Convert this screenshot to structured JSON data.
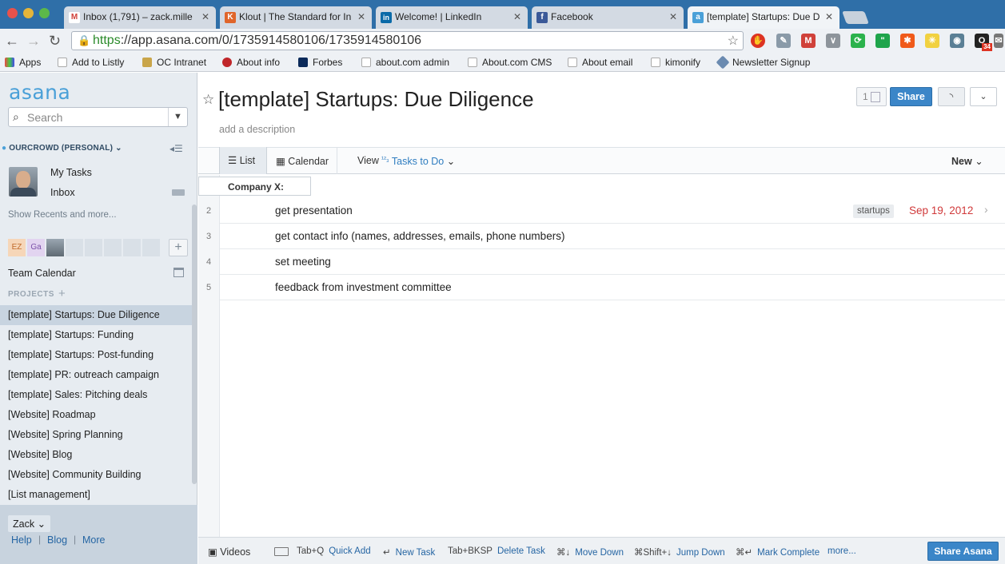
{
  "browser": {
    "tabs": [
      {
        "title": "Inbox (1,791) – zack.mille",
        "icon": "gmail-icon",
        "color": "#d0413a",
        "glyph": "M"
      },
      {
        "title": "Klout | The Standard for In",
        "icon": "klout-icon",
        "color": "#e0652a",
        "glyph": "K"
      },
      {
        "title": "Welcome! | LinkedIn",
        "icon": "linkedin-icon",
        "color": "#0a6aa8",
        "glyph": "in"
      },
      {
        "title": "Facebook",
        "icon": "facebook-icon",
        "color": "#3b5998",
        "glyph": "f"
      },
      {
        "title": "[template] Startups: Due D",
        "icon": "asana-icon",
        "color": "#4aa0d8",
        "glyph": "a"
      }
    ],
    "url_scheme": "https",
    "url_rest": "://app.asana.com/0/1735914580106/1735914580106",
    "extension_badge": "34",
    "bookmarks": [
      "Apps",
      "Add to Listly",
      "OC Intranet",
      "About info",
      "Forbes",
      "about.com admin",
      "About.com CMS",
      "About email",
      "kimonify",
      "Newsletter Signup"
    ]
  },
  "sidebar": {
    "logo": "asana",
    "search_placeholder": "Search",
    "workspace": "OURCROWD (PERSONAL)",
    "my_tasks": "My Tasks",
    "inbox": "Inbox",
    "show_recents": "Show Recents and more...",
    "members": [
      {
        "initials": "EZ",
        "bg": "#f6d6b8",
        "fg": "#c06a2a"
      },
      {
        "initials": "Ga",
        "bg": "#e2d4f0",
        "fg": "#7a4fa8"
      }
    ],
    "team_calendar": "Team Calendar",
    "projects_header": "PROJECTS",
    "projects": [
      "[template] Startups: Due Diligence",
      "[template] Startups: Funding",
      "[template] Startups: Post-funding",
      "[template] PR: outreach campaign",
      "[template] Sales: Pitching deals",
      "[Website] Roadmap",
      "[Website] Spring Planning",
      "[Website] Blog",
      "[Website] Community Building",
      "[List management]"
    ],
    "selected_project_index": 0,
    "user": "Zack",
    "footer_links": [
      "Help",
      "Blog",
      "More"
    ]
  },
  "project": {
    "title": "[template] Startups: Due Diligence",
    "description_placeholder": "add a description",
    "follower_count": "1",
    "share_label": "Share",
    "tabs": {
      "list": "List",
      "calendar": "Calendar"
    },
    "view_label": "View",
    "view_sort_icon": "¹²₃",
    "view_value": "Tasks to Do",
    "new_label": "New",
    "section": "Company X:",
    "tasks": [
      {
        "num": "2",
        "name": "get presentation",
        "tag": "startups",
        "due": "Sep 19, 2012"
      },
      {
        "num": "3",
        "name": "get contact info (names, addresses, emails, phone numbers)",
        "tag": "",
        "due": ""
      },
      {
        "num": "4",
        "name": "set meeting",
        "tag": "",
        "due": ""
      },
      {
        "num": "5",
        "name": "feedback from investment committee",
        "tag": "",
        "due": ""
      }
    ]
  },
  "shortcuts": {
    "videos": "Videos",
    "items": [
      {
        "keys": "Tab+Q",
        "action": "Quick Add"
      },
      {
        "keys": "↵",
        "action": "New Task"
      },
      {
        "keys": "Tab+BKSP",
        "action": "Delete Task"
      },
      {
        "keys": "⌘↓",
        "action": "Move Down"
      },
      {
        "keys": "⌘Shift+↓",
        "action": "Jump Down"
      },
      {
        "keys": "⌘↵",
        "action": "Mark Complete"
      }
    ],
    "more": "more...",
    "share_asana": "Share Asana"
  },
  "colors": {
    "accent": "#3b86c8",
    "due_red": "#d0393a",
    "link": "#2f7dc0"
  }
}
